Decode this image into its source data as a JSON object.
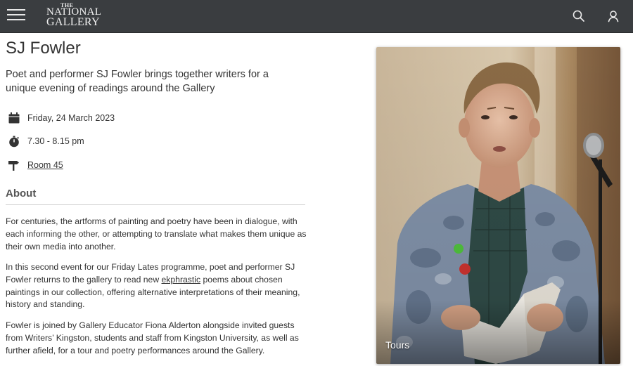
{
  "header": {
    "logo": {
      "line1": "THE",
      "line2": "NATIONAL",
      "line3": "GALLERY"
    },
    "menu_icon": "hamburger-menu-icon",
    "search_icon": "search-icon",
    "account_icon": "user-icon",
    "background_color": "#3a3d40"
  },
  "event": {
    "title": "SJ Fowler",
    "intro": "Poet and performer SJ Fowler brings together writers for a unique evening of readings around the Gallery",
    "date": "Friday, 24 March 2023",
    "time": "7.30 - 8.15 pm",
    "location": "Room 45",
    "date_icon": "calendar-icon",
    "time_icon": "stopwatch-icon",
    "location_icon": "signpost-icon"
  },
  "about": {
    "heading": "About",
    "p1": "For centuries, the artforms of painting and poetry have been in dialogue, with each informing the other, or attempting to translate what makes them unique as their own media into another.",
    "p2_before": "In this second event for our Friday Lates programme, poet and performer SJ Fowler returns to the gallery to read new ",
    "p2_link": "ekphrastic",
    "p2_after": " poems about chosen paintings in our collection, offering alternative interpretations of their meaning, history and standing.",
    "p3": "Fowler is joined by Gallery Educator Fiona Alderton alongside invited guests from Writers’ Kingston, students and staff from Kingston University, as well as further afield, for a tour and poetry performances around the Gallery."
  },
  "image_card": {
    "tag": "Tours"
  }
}
